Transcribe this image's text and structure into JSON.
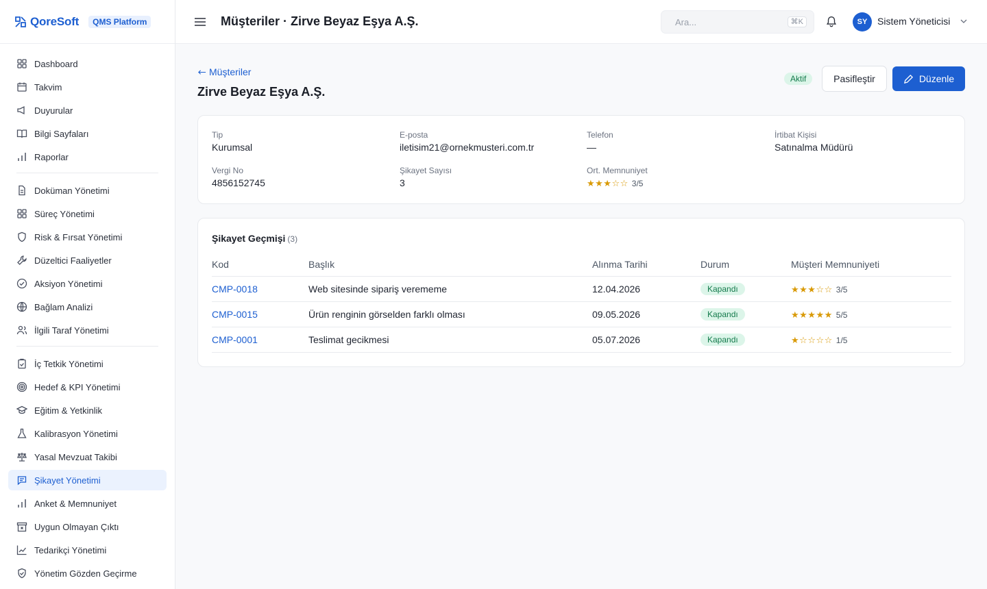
{
  "brand": {
    "name": "QoreSoft",
    "tag": "QMS Platform"
  },
  "sidebar": {
    "groups": [
      [
        {
          "label": "Dashboard",
          "icon": "grid-icon"
        },
        {
          "label": "Takvim",
          "icon": "calendar-icon"
        },
        {
          "label": "Duyurular",
          "icon": "megaphone-icon"
        },
        {
          "label": "Bilgi Sayfaları",
          "icon": "book-icon"
        },
        {
          "label": "Raporlar",
          "icon": "bar-chart-icon"
        }
      ],
      [
        {
          "label": "Doküman Yönetimi",
          "icon": "document-icon"
        },
        {
          "label": "Süreç Yönetimi",
          "icon": "grid-icon"
        },
        {
          "label": "Risk & Fırsat Yönetimi",
          "icon": "shield-icon"
        },
        {
          "label": "Düzeltici Faaliyetler",
          "icon": "wrench-icon"
        },
        {
          "label": "Aksiyon Yönetimi",
          "icon": "check-circle-icon"
        },
        {
          "label": "Bağlam Analizi",
          "icon": "globe-icon"
        },
        {
          "label": "İlgili Taraf Yönetimi",
          "icon": "users-icon"
        }
      ],
      [
        {
          "label": "İç Tetkik Yönetimi",
          "icon": "clipboard-check-icon"
        },
        {
          "label": "Hedef & KPI Yönetimi",
          "icon": "target-icon"
        },
        {
          "label": "Eğitim & Yetkinlik",
          "icon": "graduation-cap-icon"
        },
        {
          "label": "Kalibrasyon Yönetimi",
          "icon": "flask-icon"
        },
        {
          "label": "Yasal Mevzuat Takibi",
          "icon": "scale-icon"
        },
        {
          "label": "Şikayet Yönetimi",
          "icon": "message-icon",
          "active": true
        },
        {
          "label": "Anket & Memnuniyet",
          "icon": "bar-chart-icon"
        },
        {
          "label": "Uygun Olmayan Çıktı",
          "icon": "archive-x-icon"
        },
        {
          "label": "Tedarikçi Yönetimi",
          "icon": "line-chart-icon"
        },
        {
          "label": "Yönetim Gözden Geçirme",
          "icon": "shield-check-icon"
        }
      ]
    ]
  },
  "header": {
    "title": "Müşteriler · Zirve Beyaz Eşya A.Ş.",
    "search_placeholder": "Ara...",
    "search_shortcut": "⌘K",
    "user_initials": "SY",
    "user_name": "Sistem Yöneticisi"
  },
  "page": {
    "back_label": "Müşteriler",
    "title": "Zirve Beyaz Eşya A.Ş.",
    "status": "Aktif",
    "deactivate_label": "Pasifleştir",
    "edit_label": "Düzenle"
  },
  "info": {
    "type_label": "Tip",
    "type_value": "Kurumsal",
    "email_label": "E-posta",
    "email_value": "iletisim21@ornekmusteri.com.tr",
    "phone_label": "Telefon",
    "phone_value": "—",
    "contact_label": "İrtibat Kişisi",
    "contact_value": "Satınalma Müdürü",
    "tax_label": "Vergi No",
    "tax_value": "4856152745",
    "complaints_label": "Şikayet Sayısı",
    "complaints_value": "3",
    "satisfaction_label": "Ort. Memnuniyet",
    "satisfaction_value": 3,
    "satisfaction_text": "3/5"
  },
  "history": {
    "title": "Şikayet Geçmişi",
    "count": "(3)",
    "columns": [
      "Kod",
      "Başlık",
      "Alınma Tarihi",
      "Durum",
      "Müşteri Memnuniyeti"
    ],
    "rows": [
      {
        "code": "CMP-0018",
        "title": "Web sitesinde sipariş verememe",
        "date": "12.04.2026",
        "status": "Kapandı",
        "rating": 3,
        "rating_text": "3/5"
      },
      {
        "code": "CMP-0015",
        "title": "Ürün renginin görselden farklı olması",
        "date": "09.05.2026",
        "status": "Kapandı",
        "rating": 5,
        "rating_text": "5/5"
      },
      {
        "code": "CMP-0001",
        "title": "Teslimat gecikmesi",
        "date": "05.07.2026",
        "status": "Kapandı",
        "rating": 1,
        "rating_text": "1/5"
      }
    ]
  },
  "colors": {
    "accent": "#1d5fd1",
    "success_bg": "#dcf5e9",
    "success_text": "#137a4b",
    "star": "#d99a07"
  }
}
